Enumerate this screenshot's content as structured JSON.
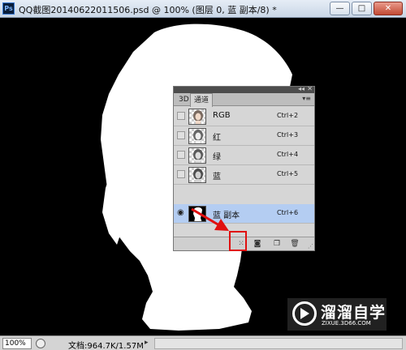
{
  "window": {
    "app_icon": "Ps",
    "title": "QQ截图20140622011506.psd @ 100% (图层 0, 蓝 副本/8) *",
    "minimize_glyph": "—",
    "maximize_glyph": "□",
    "close_glyph": "✕"
  },
  "channels_panel": {
    "tabs": [
      {
        "label": "3D",
        "active": false
      },
      {
        "label": "通道",
        "active": true
      }
    ],
    "channels": [
      {
        "name": "RGB",
        "shortcut": "Ctrl+2",
        "visible": false,
        "selected": false,
        "thumb": "color"
      },
      {
        "name": "红",
        "shortcut": "Ctrl+3",
        "visible": false,
        "selected": false,
        "thumb": "color"
      },
      {
        "name": "绿",
        "shortcut": "Ctrl+4",
        "visible": false,
        "selected": false,
        "thumb": "color"
      },
      {
        "name": "蓝",
        "shortcut": "Ctrl+5",
        "visible": false,
        "selected": false,
        "thumb": "color"
      },
      {
        "name": "蓝 副本",
        "shortcut": "Ctrl+6",
        "visible": true,
        "selected": true,
        "thumb": "mask"
      }
    ],
    "bottom_buttons": [
      "load-channel-as-selection",
      "save-selection-as-channel",
      "create-new-channel",
      "delete-channel"
    ]
  },
  "statusbar": {
    "zoom": "100%",
    "doc_info": "文档:964.7K/1.57M"
  },
  "watermark": {
    "text_cn": "溜溜自学",
    "text_en": "ZIXUE.3D66.COM"
  },
  "colors": {
    "selection_row": "#b4cdf2",
    "highlight_box": "#e01010",
    "arrow": "#e01010"
  }
}
